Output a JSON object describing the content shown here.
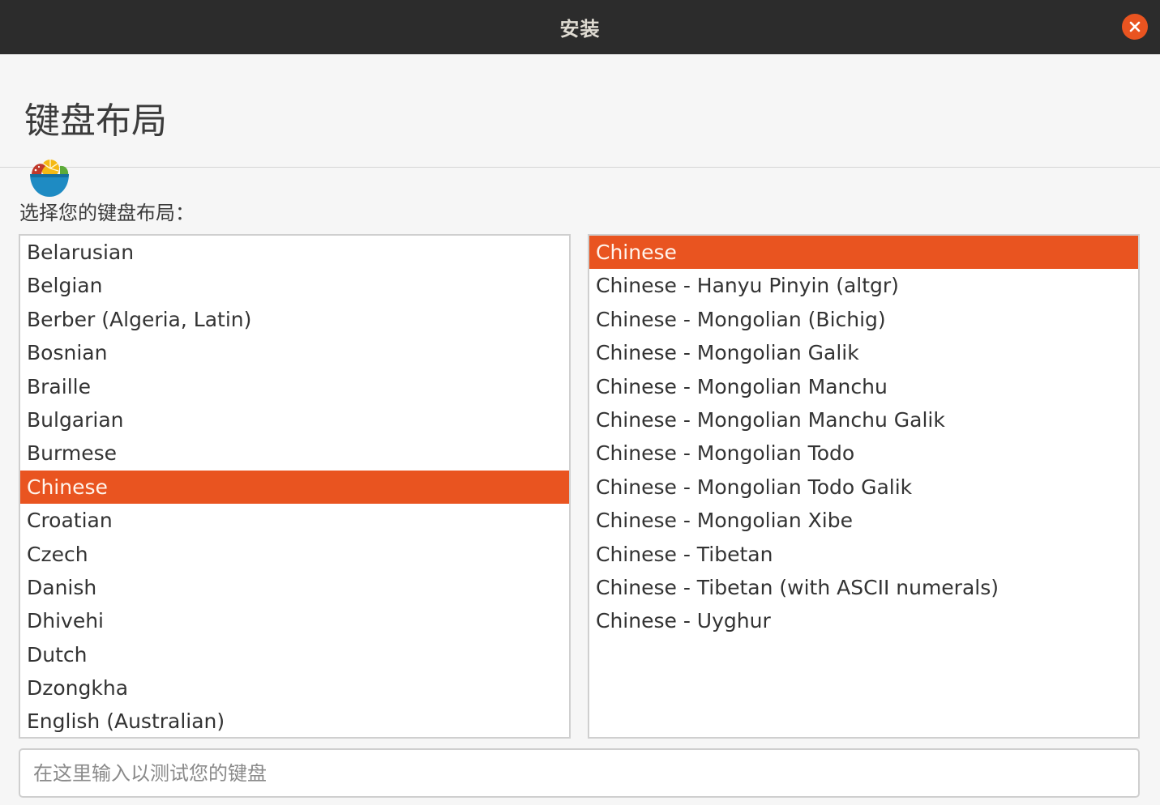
{
  "window": {
    "title": "安装",
    "colors": {
      "titlebar": "#2c2c2c",
      "accent": "#e95420"
    }
  },
  "header": {
    "title": "键盘布局"
  },
  "main": {
    "prompt": "选择您的键盘布局：",
    "layouts": [
      "Belarusian",
      "Belgian",
      "Berber (Algeria, Latin)",
      "Bosnian",
      "Braille",
      "Bulgarian",
      "Burmese",
      "Chinese",
      "Croatian",
      "Czech",
      "Danish",
      "Dhivehi",
      "Dutch",
      "Dzongkha",
      "English (Australian)"
    ],
    "selected_layout": "Chinese",
    "variants": [
      "Chinese",
      "Chinese - Hanyu Pinyin (altgr)",
      "Chinese - Mongolian (Bichig)",
      "Chinese - Mongolian Galik",
      "Chinese - Mongolian Manchu",
      "Chinese - Mongolian Manchu Galik",
      "Chinese - Mongolian Todo",
      "Chinese - Mongolian Todo Galik",
      "Chinese - Mongolian Xibe",
      "Chinese - Tibetan",
      "Chinese - Tibetan (with ASCII numerals)",
      "Chinese - Uyghur"
    ],
    "selected_variant": "Chinese",
    "test_input": {
      "value": "",
      "placeholder": "在这里输入以测试您的键盘"
    }
  },
  "icons": {
    "close": "close-icon",
    "logo": "fruit-bowl-logo-icon"
  }
}
